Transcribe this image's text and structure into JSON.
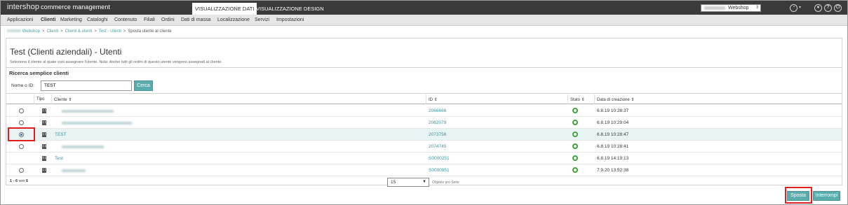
{
  "topbar": {
    "brand_main": "intershop",
    "brand_sub": "commerce management",
    "tabs": [
      {
        "label": "VISUALIZZAZIONE DATI",
        "active": true
      },
      {
        "label": "VISUALIZZAZIONE DESIGN",
        "active": false
      }
    ],
    "site_select_value": "Webshop",
    "icons": [
      "gauge-icon",
      "user-icon",
      "help-icon",
      "logout-icon"
    ]
  },
  "menu": [
    {
      "label": "Applicazioni",
      "active": false
    },
    {
      "label": "Clienti",
      "active": true
    },
    {
      "label": "Marketing",
      "active": false
    },
    {
      "label": "Cataloghi",
      "active": false
    },
    {
      "label": "Contenuto",
      "active": false
    },
    {
      "label": "Filiali",
      "active": false
    },
    {
      "label": "Ordini",
      "active": false
    },
    {
      "label": "Dati di massa",
      "active": false
    },
    {
      "label": "Localizzazione",
      "active": false
    },
    {
      "label": "Servizi",
      "active": false
    },
    {
      "label": "Impostazioni",
      "active": false
    }
  ],
  "breadcrumb": {
    "items": [
      "Webshop",
      "Clienti",
      "Clienti & utenti",
      "Test - Utenti"
    ],
    "current": "Sposta utente al cliente",
    "separator": ">"
  },
  "page": {
    "title": "Test (Clienti aziendali) - Utenti",
    "subtitle": "Seleziona il cliente al quale vuoi assegnare l'utente. Nota: Anche tutti gli ordini di questo utente vengono assegnati al cliente."
  },
  "search": {
    "heading": "Ricerca semplice clienti",
    "label": "Nome o ID:",
    "value": "TEST",
    "button": "Cerca"
  },
  "table": {
    "columns": [
      "Tipo",
      "Cliente ⇕",
      "ID ⇕",
      "Stato ⇕",
      "Data di creazione ⇕"
    ],
    "rows": [
      {
        "radio": true,
        "selected": false,
        "name": "",
        "id": "2066666",
        "date": "6.8.19 10:28:37"
      },
      {
        "radio": true,
        "selected": false,
        "name": "",
        "id": "2062079",
        "date": "6.8.19 10:29:04"
      },
      {
        "radio": true,
        "selected": true,
        "name": "TEST",
        "id": "2073756",
        "date": "6.8.19 10:28:47"
      },
      {
        "radio": true,
        "selected": false,
        "name": "",
        "id": "2074745",
        "date": "6.8.19 10:28:41"
      },
      {
        "radio": false,
        "selected": false,
        "name": "Test",
        "id": "S0000251",
        "date": "6.8.19 14:19:13"
      },
      {
        "radio": true,
        "selected": false,
        "name": "",
        "id": "S0000951",
        "date": "7.9.20 13:52:38"
      }
    ]
  },
  "paging": {
    "range": "1 - 6",
    "of_label": "von",
    "total": "6",
    "per_page_value": "15",
    "per_page_label": "Objekte pro Seite"
  },
  "actions": {
    "move": "Sposta",
    "cancel": "Interrompi"
  },
  "colors": {
    "accent": "#5aacad",
    "link": "#3a93a3",
    "highlight": "#e01e1e",
    "status_ok": "#3aa535"
  }
}
